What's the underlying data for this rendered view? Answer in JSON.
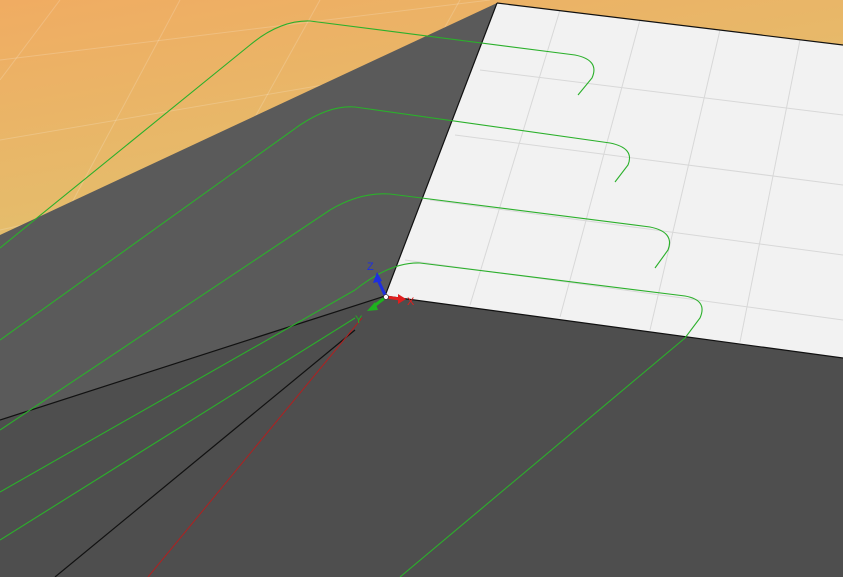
{
  "viewport": {
    "colors": {
      "background_top": "#f0ac62",
      "background_bottom": "#d2d77b",
      "top_face": "#f2f2f2",
      "left_face": "#5a5a5a",
      "front_face": "#4e4e4e",
      "edge": "#111111",
      "grid": "#d8d8d8",
      "toolpath": "#2bb02b",
      "x_axis_line": "#b02020"
    }
  },
  "triad": {
    "x_label": "X",
    "y_label": "Y",
    "z_label": "Z",
    "x_color": "#e01e1e",
    "y_color": "#1fb21f",
    "z_color": "#1e2fe0"
  }
}
